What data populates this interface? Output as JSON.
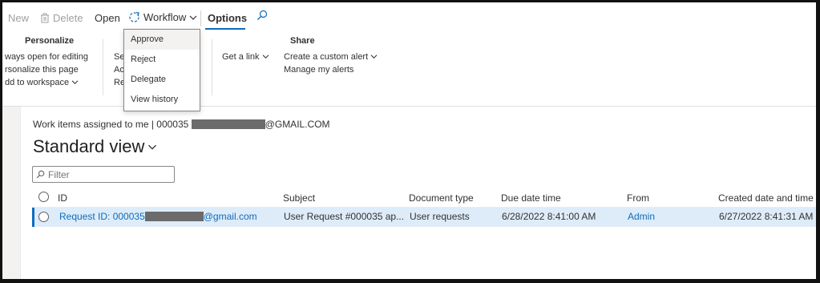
{
  "toolbar": {
    "new_label": "New",
    "delete_label": "Delete",
    "open_label": "Open",
    "workflow_label": "Workflow",
    "options_label": "Options"
  },
  "ribbon": {
    "personalize": {
      "heading": "Personalize",
      "lines": [
        "ways open for editing",
        "rsonalize this page",
        "dd to workspace"
      ]
    },
    "partial_group": {
      "lines": [
        "Se",
        "Ac",
        "Re"
      ]
    },
    "link_group": {
      "get_link_label": "Get a link"
    },
    "share": {
      "heading": "Share",
      "create_alert_label": "Create a custom alert",
      "manage_alerts_label": "Manage my alerts"
    }
  },
  "workflow_menu": {
    "items": [
      "Approve",
      "Reject",
      "Delegate",
      "View history"
    ]
  },
  "content": {
    "caption_prefix": "Work items assigned to me  |  000035",
    "caption_suffix": "@GMAIL.COM",
    "title": "Standard view",
    "filter_placeholder": "Filter"
  },
  "grid": {
    "columns": [
      "ID",
      "Subject",
      "Document type",
      "Due date time",
      "From",
      "Created date and time"
    ],
    "rows": [
      {
        "id_prefix": "Request ID: 000035",
        "id_suffix": "@gmail.com",
        "subject": "User Request #000035 ap...",
        "document_type": "User requests",
        "due_date_time": "6/28/2022 8:41:00 AM",
        "from": "Admin",
        "created": "6/27/2022 8:41:31 AM"
      }
    ]
  },
  "colors": {
    "accent": "#0f6cbd",
    "selected_row": "#deecf9"
  },
  "icons": {
    "delete": "trash-icon",
    "workflow": "refresh-icon",
    "search": "search-icon",
    "filter": "search-icon",
    "chevron": "chevron-down-icon"
  }
}
